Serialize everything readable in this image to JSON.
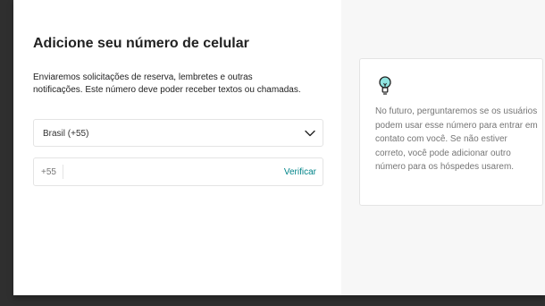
{
  "page": {
    "title": "Adicione seu número de celular",
    "description": "Enviaremos solicitações de reserva, lembretes e outras notificações. Este número deve poder receber textos ou chamadas."
  },
  "country_select": {
    "value": "Brasil (+55)",
    "icon": "chevron-down-icon"
  },
  "phone_field": {
    "prefix": "+55",
    "value": "",
    "verify_label": "Verificar"
  },
  "tip": {
    "icon": "lightbulb-icon",
    "text": "No futuro, perguntaremos se os usuários podem usar esse número para entrar em contato com você. Se não estiver correto, você pode adicionar outro número para os hóspedes usarem."
  },
  "colors": {
    "accent": "#008489",
    "title": "#222222",
    "muted": "#767676",
    "aside_bg": "#f7f7f7",
    "border": "#e4e4e4"
  }
}
